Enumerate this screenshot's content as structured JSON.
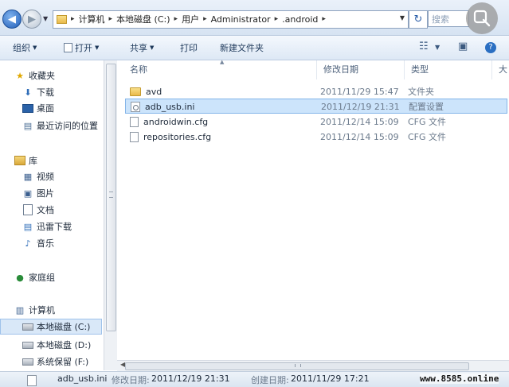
{
  "address_bar": {
    "breadcrumbs": [
      "计算机",
      "本地磁盘 (C:)",
      "用户",
      "Administrator",
      ".android"
    ],
    "search_placeholder": "搜索"
  },
  "toolbar": {
    "organize": "组织",
    "open": "打开",
    "share": "共享",
    "print": "打印",
    "new_folder": "新建文件夹"
  },
  "nav": {
    "favorites": "收藏夹",
    "downloads": "下载",
    "desktop": "桌面",
    "recent": "最近访问的位置",
    "libraries": "库",
    "videos": "视频",
    "pictures": "图片",
    "documents": "文档",
    "thunder": "迅雷下载",
    "music": "音乐",
    "homegroup": "家庭组",
    "computer": "计算机",
    "drive_c": "本地磁盘 (C:)",
    "drive_d": "本地磁盘 (D:)",
    "drive_f": "系统保留 (F:)"
  },
  "columns": {
    "name": "名称",
    "modified": "修改日期",
    "type": "类型",
    "size": "大"
  },
  "files": [
    {
      "name": "avd",
      "modified": "2011/11/29 15:47",
      "type": "文件夹"
    },
    {
      "name": "adb_usb.ini",
      "modified": "2011/12/19 21:31",
      "type": "配置设置"
    },
    {
      "name": "androidwin.cfg",
      "modified": "2011/12/14 15:09",
      "type": "CFG 文件"
    },
    {
      "name": "repositories.cfg",
      "modified": "2011/12/14 15:09",
      "type": "CFG 文件"
    }
  ],
  "details": {
    "filename": "adb_usb.ini",
    "modified_label": "修改日期:",
    "modified_value": "2011/12/19 21:31",
    "created_label": "创建日期:",
    "created_value": "2011/11/29 17:21"
  },
  "watermark": "www.8585.online"
}
